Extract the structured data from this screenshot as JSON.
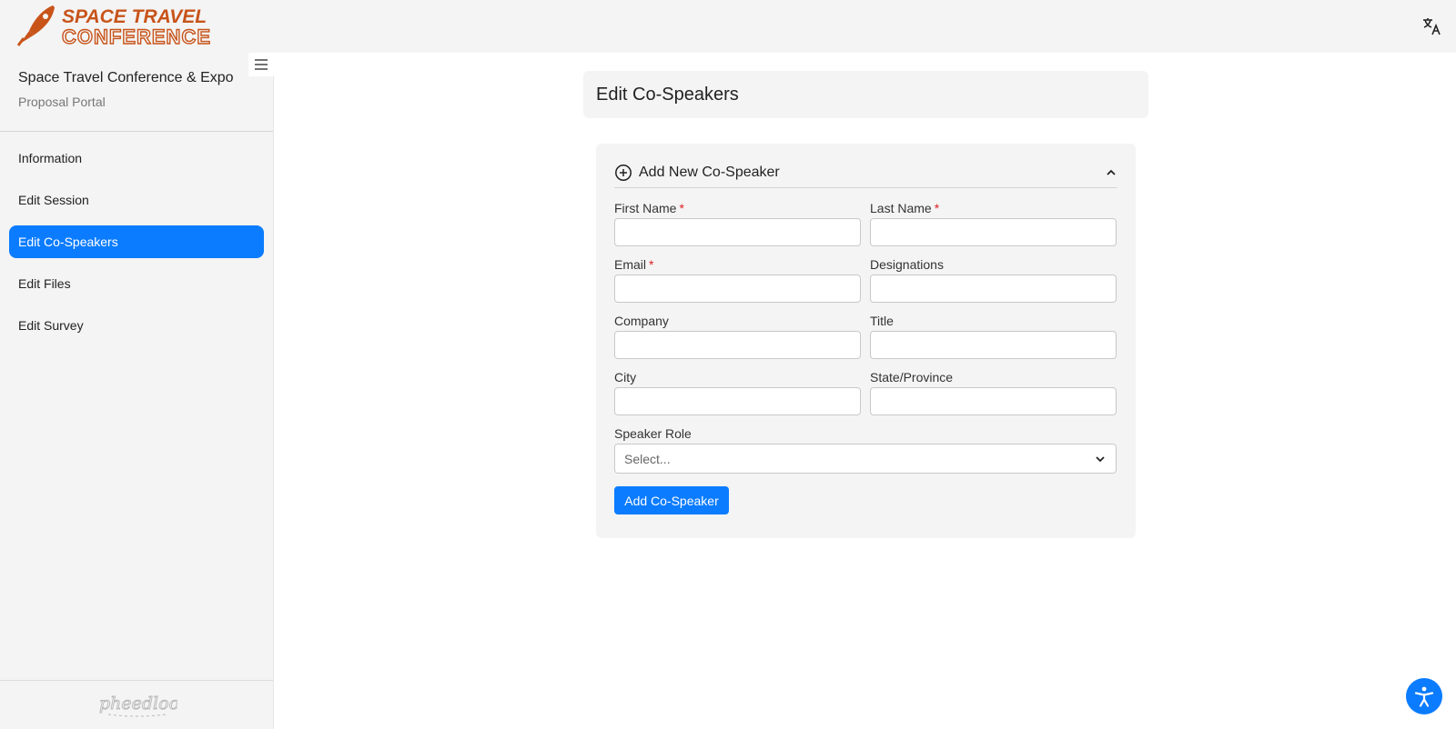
{
  "brand": {
    "logo_line1": "SPACE TRAVEL",
    "logo_line2": "CONFERENCE",
    "logo_color": "#c8541a",
    "logo_icon": "rocket-icon"
  },
  "header": {
    "translate_icon": "translate-icon"
  },
  "sidebar": {
    "event_title": "Space Travel Conference & Expo",
    "event_subtitle": "Proposal Portal",
    "menu_icon": "hamburger-icon",
    "items": [
      {
        "label": "Information",
        "active": false
      },
      {
        "label": "Edit Session",
        "active": false
      },
      {
        "label": "Edit Co-Speakers",
        "active": true
      },
      {
        "label": "Edit Files",
        "active": false
      },
      {
        "label": "Edit Survey",
        "active": false
      }
    ],
    "footer_logo": "pheedloop"
  },
  "page": {
    "title": "Edit Co-Speakers",
    "form": {
      "header": "Add New Co-Speaker",
      "first_name_label": "First Name",
      "last_name_label": "Last Name",
      "email_label": "Email",
      "designations_label": "Designations",
      "company_label": "Company",
      "title_label": "Title",
      "city_label": "City",
      "state_label": "State/Province",
      "speaker_role_label": "Speaker Role",
      "speaker_role_value": "Select...",
      "required_mark": "*",
      "submit_label": "Add Co-Speaker"
    }
  },
  "colors": {
    "accent": "#0b7cff",
    "required": "#dd2222"
  }
}
